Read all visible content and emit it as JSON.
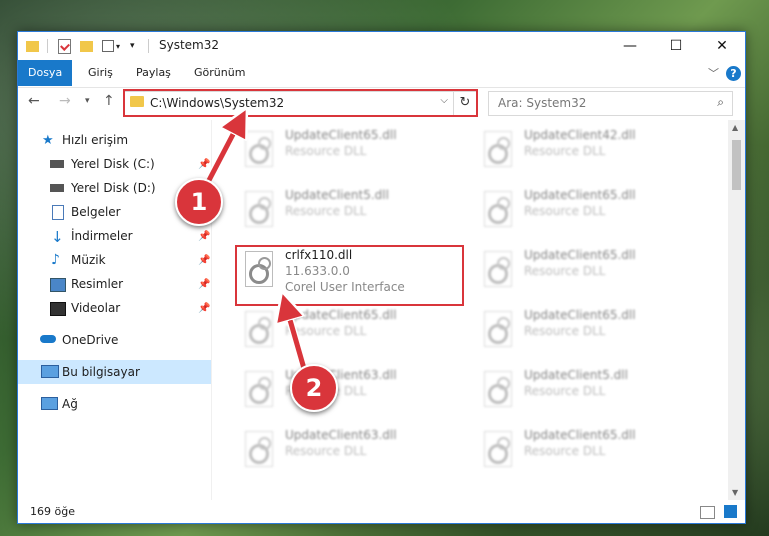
{
  "window": {
    "title": "System32"
  },
  "ribbon": {
    "tabs": [
      "Dosya",
      "Giriş",
      "Paylaş",
      "Görünüm"
    ]
  },
  "address": {
    "path": "C:\\Windows\\System32"
  },
  "search": {
    "placeholder": "Ara: System32"
  },
  "sidebar": {
    "quick_access": "Hızlı erişim",
    "items": [
      {
        "label": "Yerel Disk (C:)",
        "icon": "drive-icon"
      },
      {
        "label": "Yerel Disk (D:)",
        "icon": "drive-icon"
      },
      {
        "label": "Belgeler",
        "icon": "documents-icon"
      },
      {
        "label": "İndirmeler",
        "icon": "download-icon"
      },
      {
        "label": "Müzik",
        "icon": "music-icon"
      },
      {
        "label": "Resimler",
        "icon": "pictures-icon"
      },
      {
        "label": "Videolar",
        "icon": "videos-icon"
      }
    ],
    "onedrive": "OneDrive",
    "this_pc": "Bu bilgisayar",
    "network": "Ağ"
  },
  "files": {
    "col1": [
      {
        "name": "UpdateClient65.dll",
        "sub": "Resource DLL"
      },
      {
        "name": "UpdateClient5.dll",
        "sub": "Resource DLL"
      },
      {
        "name": "crlfx110.dll",
        "sub": "11.633.0.0",
        "sub2": "Corel User Interface"
      },
      {
        "name": "UpdateClient65.dll",
        "sub": "Resource DLL"
      },
      {
        "name": "UpdateClient63.dll",
        "sub": "Resource DLL"
      },
      {
        "name": "UpdateClient63.dll",
        "sub": "Resource DLL"
      }
    ],
    "col2": [
      {
        "name": "UpdateClient42.dll",
        "sub": "Resource DLL"
      },
      {
        "name": "UpdateClient65.dll",
        "sub": "Resource DLL"
      },
      {
        "name": "UpdateClient65.dll",
        "sub": "Resource DLL"
      },
      {
        "name": "UpdateClient65.dll",
        "sub": "Resource DLL"
      },
      {
        "name": "UpdateClient5.dll",
        "sub": "Resource DLL"
      },
      {
        "name": "UpdateClient65.dll",
        "sub": "Resource DLL"
      }
    ]
  },
  "status": {
    "count": "169 öğe"
  },
  "markers": {
    "one": "1",
    "two": "2"
  },
  "colors": {
    "accent": "#1979ca",
    "highlight": "#d9353b"
  }
}
